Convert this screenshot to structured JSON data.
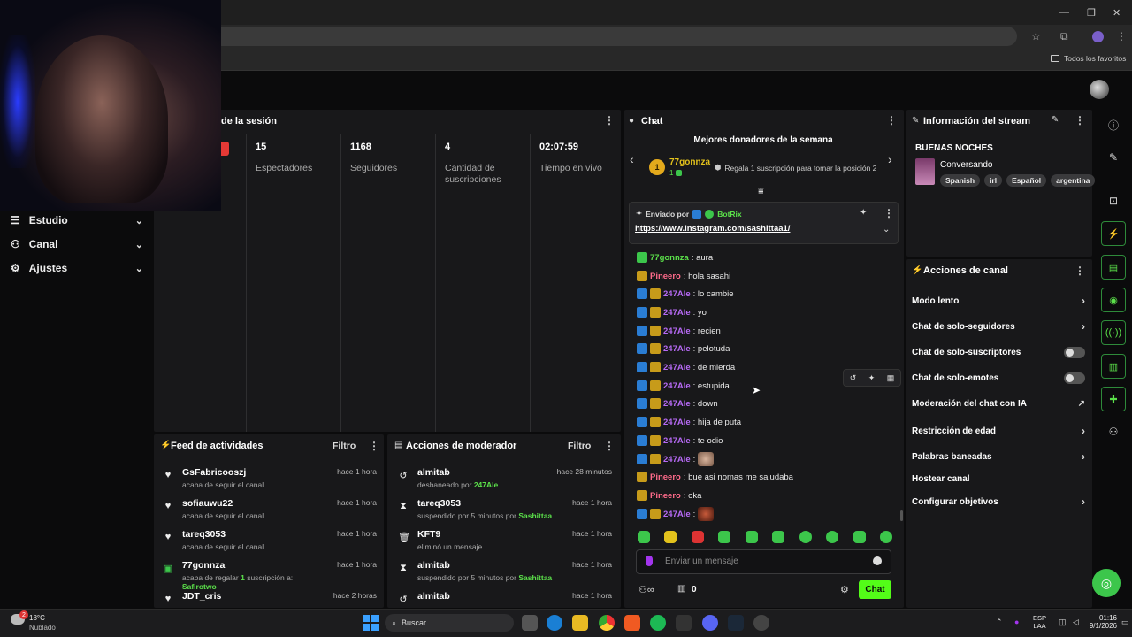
{
  "browser": {
    "bookmarks_label": "Todos los favoritos"
  },
  "sidebar": {
    "items": [
      {
        "label": "Estudio",
        "icon": "studio-icon"
      },
      {
        "label": "Canal",
        "icon": "channel-icon"
      },
      {
        "label": "Ajustes",
        "icon": "gear-icon"
      }
    ]
  },
  "session": {
    "title": "de la sesión",
    "stats": [
      {
        "value": "15",
        "label": "Espectadores"
      },
      {
        "value": "1168",
        "label": "Seguidores"
      },
      {
        "value": "4",
        "label": "Cantidad de suscripciones"
      },
      {
        "value": "02:07:59",
        "label": "Tiempo en vivo"
      }
    ]
  },
  "feed": {
    "title": "Feed de actividades",
    "filter": "Filtro",
    "items": [
      {
        "name": "GsFabricooszj",
        "sub": "acaba de seguir el canal",
        "time": "hace 1 hora",
        "icon": "heart-icon"
      },
      {
        "name": "sofiauwu22",
        "sub": "acaba de seguir el canal",
        "time": "hace 1 hora",
        "icon": "heart-icon"
      },
      {
        "name": "tareq3053",
        "sub": "acaba de seguir el canal",
        "time": "hace 1 hora",
        "icon": "heart-icon"
      },
      {
        "name": "77gonnza",
        "sub_pre": "acaba de regalar ",
        "sub_num": "1",
        "sub_mid": " suscripción a: ",
        "sub_user": "Safirotwo",
        "time": "hace 1 hora",
        "icon": "gift-icon"
      },
      {
        "name": "JDT_cris",
        "time": "hace 2 horas",
        "icon": "heart-icon"
      }
    ]
  },
  "mod": {
    "title": "Acciones de moderador",
    "filter": "Filtro",
    "items": [
      {
        "name": "almitab",
        "sub_pre": "desbaneado por ",
        "sub_user": "247Ale",
        "time": "hace 28 minutos",
        "icon": "undo-icon"
      },
      {
        "name": "tareq3053",
        "sub_pre": "suspendido por 5 minutos por ",
        "sub_user": "Sashittaa",
        "time": "hace 1 hora",
        "icon": "hourglass-icon"
      },
      {
        "name": "KFT9",
        "sub_pre": "eliminó un mensaje",
        "sub_user": "",
        "time": "hace 1 hora",
        "icon": "trash-icon"
      },
      {
        "name": "almitab",
        "sub_pre": "suspendido por 5 minutos por ",
        "sub_user": "Sashittaa",
        "time": "hace 1 hora",
        "icon": "hourglass-icon"
      },
      {
        "name": "almitab",
        "time": "hace 1 hora",
        "icon": "undo-icon"
      }
    ]
  },
  "chat": {
    "title": "Chat",
    "donors_title": "Mejores donadores de la semana",
    "donor_rank": "1",
    "donor_name": "77gonnza",
    "donor_count": "1",
    "gift_hint": "Regala 1 suscripción para tomar la posición 2",
    "pinned_by": "Enviado por",
    "pinned_user": "BotRix",
    "pinned_link": "https://www.instagram.com/sashittaa1/",
    "messages": [
      {
        "user": "77gonnza",
        "text": ": aura",
        "color": "green",
        "badges": [
          "green"
        ]
      },
      {
        "user": "Pineero",
        "text": ": hola sasahi",
        "color": "pink",
        "badges": [
          "gold"
        ]
      },
      {
        "user": "247Ale",
        "text": ": lo cambie",
        "color": "purple",
        "badges": [
          "blue",
          "gold"
        ]
      },
      {
        "user": "247Ale",
        "text": ": yo",
        "color": "purple",
        "badges": [
          "blue",
          "gold"
        ]
      },
      {
        "user": "247Ale",
        "text": ": recien",
        "color": "purple",
        "badges": [
          "blue",
          "gold"
        ]
      },
      {
        "user": "247Ale",
        "text": ": pelotuda",
        "color": "purple",
        "badges": [
          "blue",
          "gold"
        ]
      },
      {
        "user": "247Ale",
        "text": ": de mierda",
        "color": "purple",
        "badges": [
          "blue",
          "gold"
        ]
      },
      {
        "user": "247Ale",
        "text": ": estupida",
        "color": "purple",
        "badges": [
          "blue",
          "gold"
        ]
      },
      {
        "user": "247Ale",
        "text": ": down",
        "color": "purple",
        "badges": [
          "blue",
          "gold"
        ]
      },
      {
        "user": "247Ale",
        "text": ": hija de puta",
        "color": "purple",
        "badges": [
          "blue",
          "gold"
        ]
      },
      {
        "user": "247Ale",
        "text": ": te odio",
        "color": "purple",
        "badges": [
          "blue",
          "gold"
        ]
      },
      {
        "user": "247Ale",
        "text": ":",
        "color": "purple",
        "badges": [
          "blue",
          "gold"
        ],
        "emote": "cat-emote"
      },
      {
        "user": "Pineero",
        "text": ": bue asi nomas me saludaba",
        "color": "pink",
        "badges": [
          "gold"
        ]
      },
      {
        "user": "Pineero",
        "text": ": oka",
        "color": "pink",
        "badges": [
          "gold"
        ]
      },
      {
        "user": "247Ale",
        "text": ":",
        "color": "purple",
        "badges": [
          "blue",
          "gold"
        ],
        "emote": "face-emote"
      }
    ],
    "input_placeholder": "Enviar un mensaje",
    "points": "0",
    "send_label": "Chat"
  },
  "stream_info": {
    "title": "Información del stream",
    "stream_title": "BUENAS NOCHES",
    "category": "Conversando",
    "tags": [
      "Spanish",
      "irl",
      "Español",
      "argentina"
    ]
  },
  "channel_actions": {
    "title": "Acciones de canal",
    "items": [
      {
        "label": "Modo lento",
        "control": "arrow"
      },
      {
        "label": "Chat de solo-seguidores",
        "control": "arrow"
      },
      {
        "label": "Chat de solo-suscriptores",
        "control": "toggle"
      },
      {
        "label": "Chat de solo-emotes",
        "control": "toggle"
      },
      {
        "label": "Moderación del chat con IA",
        "control": "external"
      },
      {
        "label": "Restricción de edad",
        "control": "arrow"
      },
      {
        "label": "Palabras baneadas",
        "control": "arrow"
      },
      {
        "label": "Hostear canal",
        "control": "none"
      },
      {
        "label": "Configurar objetivos",
        "control": "arrow"
      }
    ]
  },
  "taskbar": {
    "weather_temp": "18°C",
    "weather_desc": "Nublado",
    "weather_badge": "2",
    "search": "Buscar",
    "lang": "ESP",
    "lang2": "LAA",
    "time": "01:16",
    "date": "9/1/2026"
  },
  "colors": {
    "accent": "#53fc18",
    "purple_user": "#b76af5",
    "pink_user": "#ff6b8b"
  }
}
